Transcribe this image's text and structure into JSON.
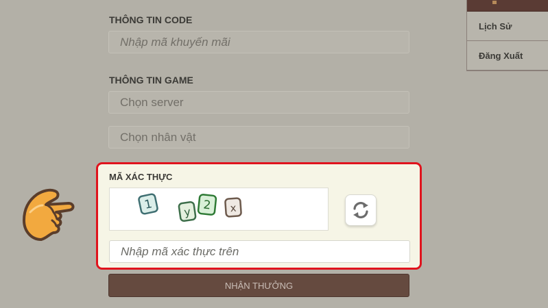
{
  "code_section": {
    "title": "THÔNG TIN CODE",
    "promo_placeholder": "Nhập mã khuyến mãi"
  },
  "game_section": {
    "title": "THÔNG TIN GAME",
    "server_select": "Chọn server",
    "character_select": "Chọn nhân vật"
  },
  "captcha": {
    "title": "MÃ XÁC THỰC",
    "characters": [
      "1",
      "y",
      "2",
      "x"
    ],
    "input_placeholder": "Nhập mã xác thực trên"
  },
  "submit_label": "NHẬN THƯỞNG",
  "side_menu": {
    "items": [
      {
        "label": "Lịch Sử"
      },
      {
        "label": "Đăng Xuất"
      }
    ]
  },
  "colors": {
    "highlight_border": "#e0131d",
    "submit_bg": "#654a3f",
    "hand_fill": "#f2a93f"
  },
  "icons": {
    "refresh": "refresh-icon",
    "pointer": "pointing-hand-icon"
  }
}
